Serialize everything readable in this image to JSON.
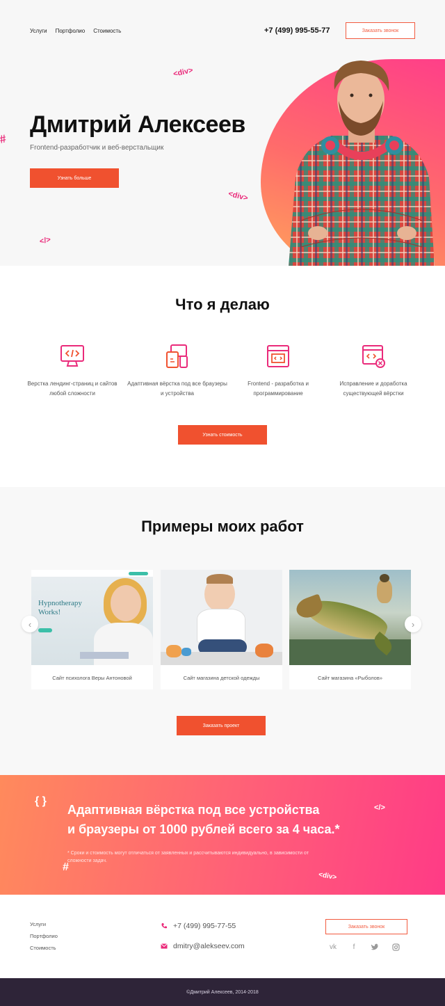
{
  "header": {
    "nav": [
      "Услуги",
      "Портфолио",
      "Стоимость"
    ],
    "phone": "+7 (499) 995-55-77",
    "call_button": "Заказать звонок"
  },
  "hero": {
    "name": "Дмитрий Алексеев",
    "subtitle": "Frontend-разработчик и веб-верстальщик",
    "more_button": "Узнать больше",
    "deco": [
      "<div>",
      "<div>",
      "</>",
      "#"
    ]
  },
  "services": {
    "title": "Что я делаю",
    "items": [
      {
        "label": "Верстка лендинг-страниц и сайтов любой сложности",
        "icon": "monitor-code-icon"
      },
      {
        "label": "Адаптивная вёрстка под все браузеры и устройства",
        "icon": "devices-icon"
      },
      {
        "label": "Frontend - разработка и программирование",
        "icon": "browser-code-icon"
      },
      {
        "label": "Исправление и доработка существующей вёрстки",
        "icon": "browser-fix-icon"
      }
    ],
    "price_button": "Узнать стоимость"
  },
  "portfolio": {
    "title": "Примеры моих работ",
    "cards": [
      {
        "caption": "Сайт психолога Веры Антоновой",
        "thumb_text": "Hypnotherapy Works!"
      },
      {
        "caption": "Сайт магазина детской одежды"
      },
      {
        "caption": "Сайт магазина «Рыболов»"
      }
    ],
    "order_button": "Заказать проект"
  },
  "promo": {
    "line1": "Адаптивная вёрстка под все устройства",
    "line2": "и браузеры от 1000 рублей всего за 4 часа.*",
    "note": "* Сроки и стоимость могут отличаться от заявленных и рассчитываются индивидуально, в зависимости от сложности задач.",
    "deco": [
      "{ }",
      "</>",
      "#",
      "<div>"
    ]
  },
  "footer": {
    "links": [
      "Услуги",
      "Портфолио",
      "Стоимость"
    ],
    "phone": "+7 (499) 995-77-55",
    "email": "dmitry@alekseev.com",
    "call_button": "Заказать звонок",
    "socials": [
      "vk-icon",
      "facebook-icon",
      "twitter-icon",
      "instagram-icon"
    ],
    "copyright": "©Дмитрий Алексеев, 2014-2018"
  },
  "colors": {
    "accent": "#f0512f",
    "pink": "#ea2a7a",
    "footer_bar": "#2e2438"
  }
}
